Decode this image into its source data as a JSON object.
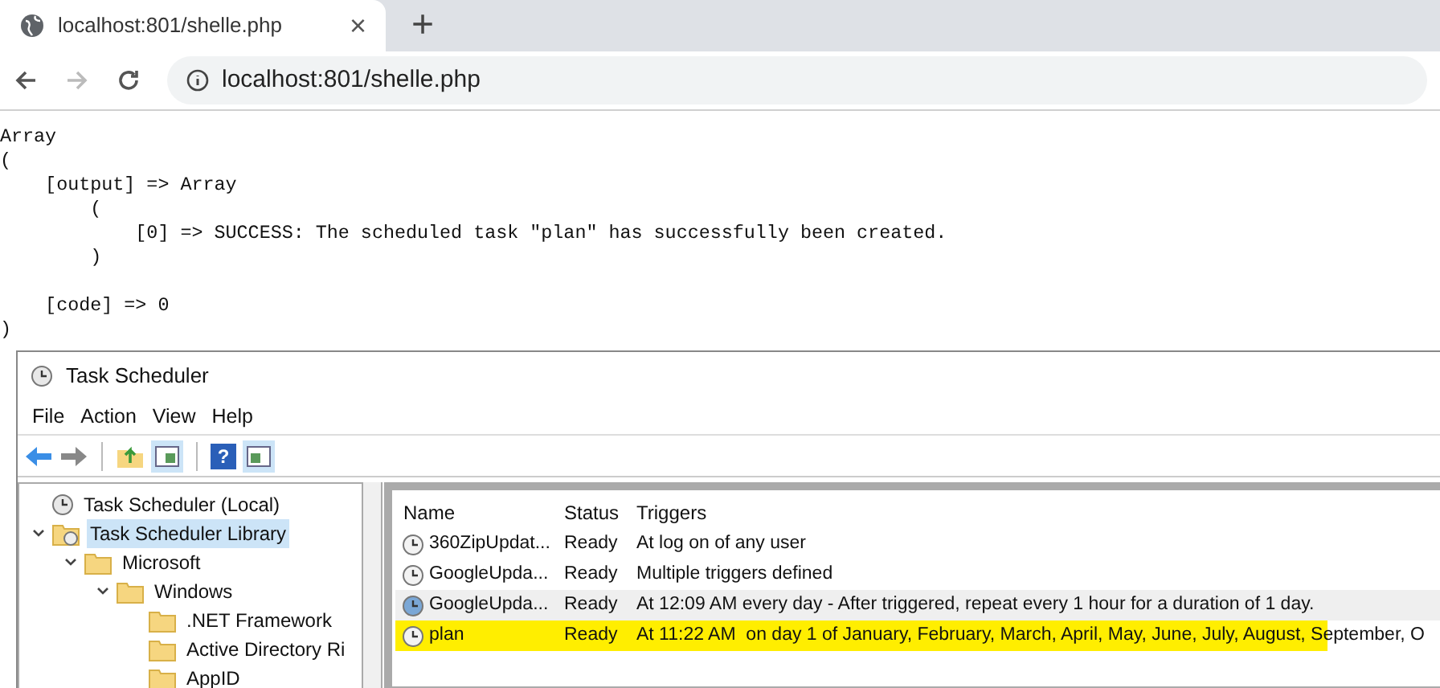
{
  "browser": {
    "tab_title": "localhost:801/shelle.php",
    "close_glyph": "×",
    "new_tab_glyph": "+",
    "url": "localhost:801/shelle.php"
  },
  "php_output": "Array\n(\n    [output] => Array\n        (\n            [0] => SUCCESS: The scheduled task \"plan\" has successfully been created.\n        )\n\n    [code] => 0\n)",
  "task_scheduler": {
    "title": "Task Scheduler",
    "menu": [
      "File",
      "Action",
      "View",
      "Help"
    ],
    "help_glyph": "?",
    "tree": [
      {
        "label": "Task Scheduler (Local)",
        "kind": "root",
        "selected": false
      },
      {
        "label": "Task Scheduler Library",
        "kind": "library",
        "selected": true,
        "expanded": true,
        "children": [
          {
            "label": "Microsoft",
            "kind": "folder",
            "selected": false,
            "expanded": true,
            "children": [
              {
                "label": "Windows",
                "kind": "folder",
                "selected": false,
                "expanded": true,
                "children": [
                  {
                    "label": ".NET Framework",
                    "kind": "folder",
                    "selected": false
                  },
                  {
                    "label": "Active Directory Ri",
                    "kind": "folder",
                    "selected": false
                  },
                  {
                    "label": "AppID",
                    "kind": "folder",
                    "selected": false
                  }
                ]
              }
            ]
          }
        ]
      }
    ],
    "columns": [
      "Name",
      "Status",
      "Triggers"
    ],
    "rows": [
      {
        "name": "360ZipUpdat...",
        "status": "Ready",
        "triggers": "At log on of any user",
        "selected": false,
        "highlighted": false,
        "kind": "idle"
      },
      {
        "name": "GoogleUpda...",
        "status": "Ready",
        "triggers": "Multiple triggers defined",
        "selected": false,
        "highlighted": false,
        "kind": "idle"
      },
      {
        "name": "GoogleUpda...",
        "status": "Ready",
        "triggers": "At 12:09 AM every day - After triggered, repeat every 1 hour for a duration of 1 day.",
        "selected": true,
        "highlighted": false,
        "kind": "active"
      },
      {
        "name": "plan",
        "status": "Ready",
        "triggers": "At 11:22 AM  on day 1 of January, February, March, April, May, June, July, August, September, O",
        "selected": false,
        "highlighted": true,
        "kind": "idle"
      }
    ]
  }
}
